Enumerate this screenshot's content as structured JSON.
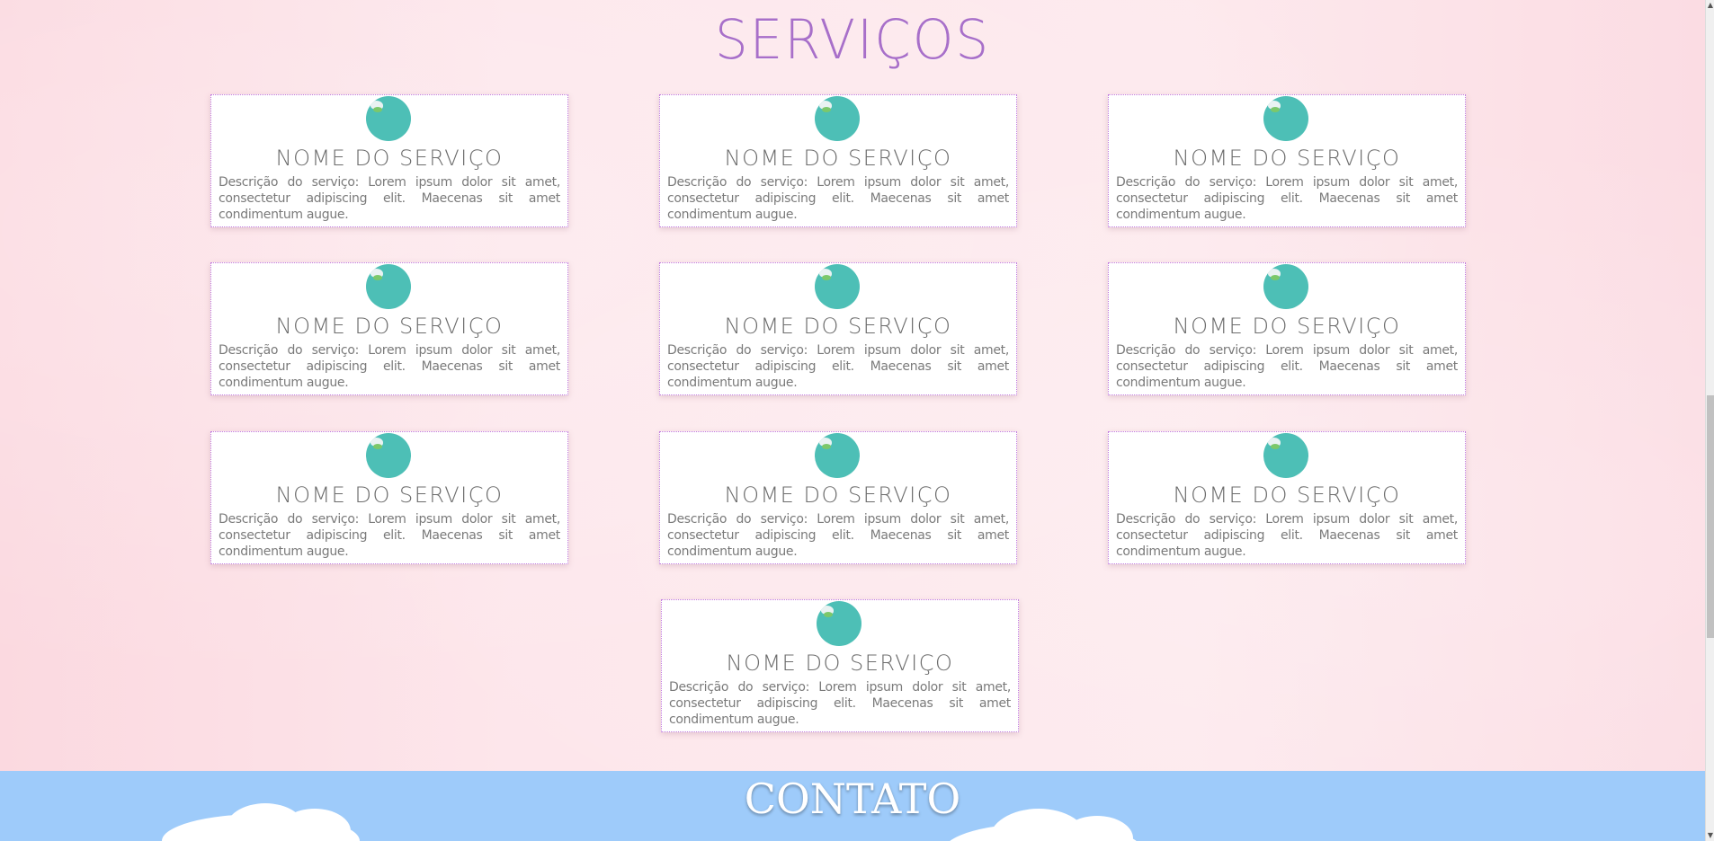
{
  "section_title": "SERVIÇOS",
  "services": [
    {
      "title": "NOME DO SERVIÇO",
      "description": "Descrição do serviço: Lorem ipsum dolor sit amet, consectetur adipiscing elit. Maecenas sit amet condimentum augue.",
      "icon": "globe-icon"
    },
    {
      "title": "NOME DO SERVIÇO",
      "description": "Descrição do serviço: Lorem ipsum dolor sit amet, consectetur adipiscing elit. Maecenas sit amet condimentum augue.",
      "icon": "globe-icon"
    },
    {
      "title": "NOME DO SERVIÇO",
      "description": "Descrição do serviço: Lorem ipsum dolor sit amet, consectetur adipiscing elit. Maecenas sit amet condimentum augue.",
      "icon": "globe-icon"
    },
    {
      "title": "NOME DO SERVIÇO",
      "description": "Descrição do serviço: Lorem ipsum dolor sit amet, consectetur adipiscing elit. Maecenas sit amet condimentum augue.",
      "icon": "globe-icon"
    },
    {
      "title": "NOME DO SERVIÇO",
      "description": "Descrição do serviço: Lorem ipsum dolor sit amet, consectetur adipiscing elit. Maecenas sit amet condimentum augue.",
      "icon": "globe-icon"
    },
    {
      "title": "NOME DO SERVIÇO",
      "description": "Descrição do serviço: Lorem ipsum dolor sit amet, consectetur adipiscing elit. Maecenas sit amet condimentum augue.",
      "icon": "globe-icon"
    },
    {
      "title": "NOME DO SERVIÇO",
      "description": "Descrição do serviço: Lorem ipsum dolor sit amet, consectetur adipiscing elit. Maecenas sit amet condimentum augue.",
      "icon": "globe-icon"
    },
    {
      "title": "NOME DO SERVIÇO",
      "description": "Descrição do serviço: Lorem ipsum dolor sit amet, consectetur adipiscing elit. Maecenas sit amet condimentum augue.",
      "icon": "globe-icon"
    },
    {
      "title": "NOME DO SERVIÇO",
      "description": "Descrição do serviço: Lorem ipsum dolor sit amet, consectetur adipiscing elit. Maecenas sit amet condimentum augue.",
      "icon": "globe-icon"
    },
    {
      "title": "NOME DO SERVIÇO",
      "description": "Descrição do serviço: Lorem ipsum dolor sit amet, consectetur adipiscing elit. Maecenas sit amet condimentum augue.",
      "icon": "globe-icon"
    }
  ],
  "contact_title": "CONTATO",
  "colors": {
    "title": "#a86fc9",
    "icon": "#4dbfb6",
    "contact_bg": "#9ecbfa",
    "page_bg": "#fde5ea"
  }
}
